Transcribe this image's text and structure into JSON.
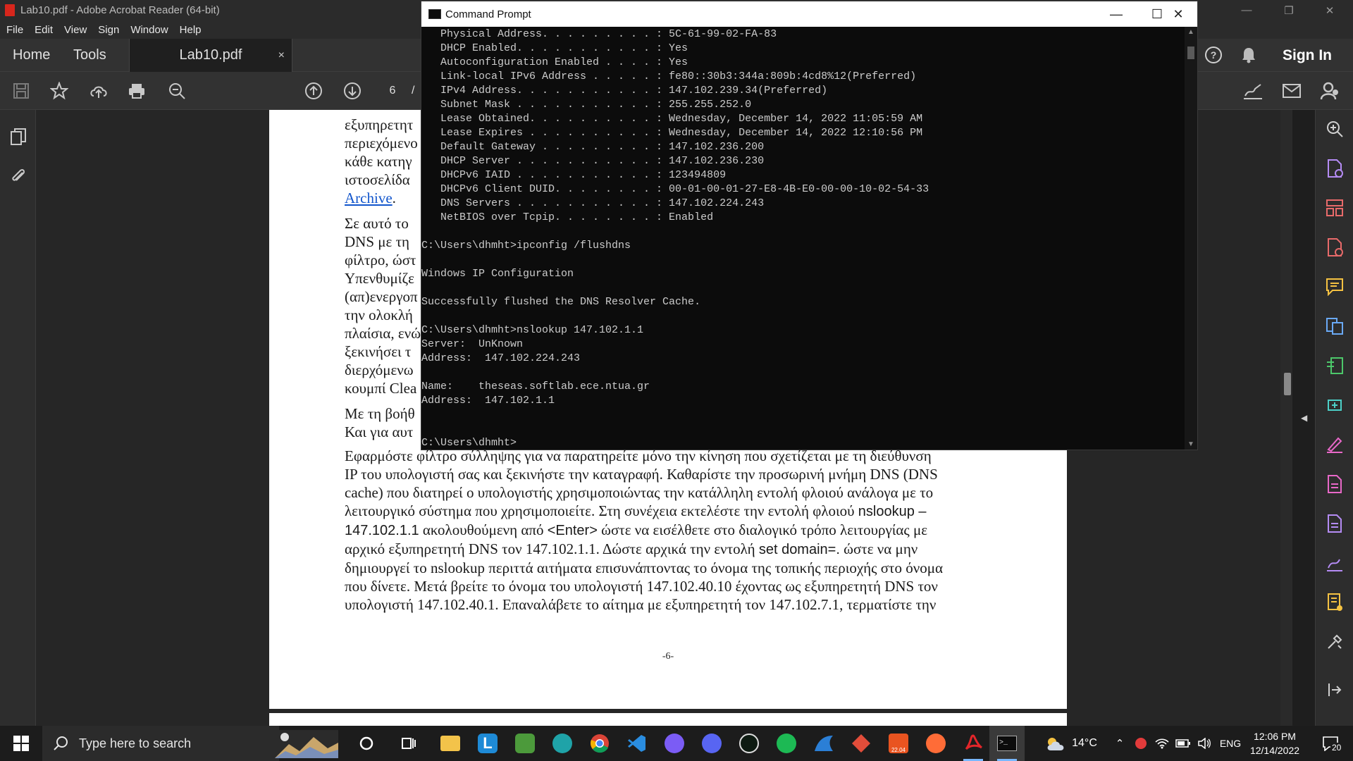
{
  "acrobat": {
    "window_title": "Lab10.pdf - Adobe Acrobat Reader (64-bit)",
    "menu": [
      "File",
      "Edit",
      "View",
      "Sign",
      "Window",
      "Help"
    ],
    "tabs": {
      "home": "Home",
      "tools": "Tools",
      "doc": "Lab10.pdf",
      "close": "×"
    },
    "sign_in": "Sign In",
    "page_number": "6",
    "page_sep": "/",
    "pdf": {
      "left_fragments": [
        "εξυπηρετητ",
        "περιεχόμενο",
        "κάθε κατηγ",
        "ιστοσελίδα",
        "Archive",
        ".",
        "Σε αυτό το",
        "DNS με τη",
        "φίλτρο, ώστ",
        "Υπενθυμίζε",
        "(απ)ενεργοπ",
        "την ολοκλή",
        "πλαίσια, ενώ",
        "ξεκινήσει τ",
        "διερχόμενω",
        "κουμπί Clea",
        "Με τη βοήθ",
        "Και για αυτ"
      ],
      "line1": "Εφαρμόστε φίλτρο σύλληψης για να παρατηρείτε μόνο την κίνηση που σχετίζεται με τη διεύθυνση",
      "line2": "IP του υπολογιστή σας και ξεκινήστε την καταγραφή. Καθαρίστε την προσωρινή μνήμη DNS (DNS",
      "line3": "cache) που διατηρεί ο υπολογιστής χρησιμοποιώντας την κατάλληλη εντολή φλοιού ανάλογα με το",
      "line4a": "λειτουργικό σύστημα που χρησιμοποιείτε. Στη συνέχεια εκτελέστε την εντολή φλοιού",
      "line4b": "nslookup –",
      "line5a": "147.102.1.1",
      "line5b": "ακολουθούμενη από",
      "line5c": "<Enter>",
      "line5d": "ώστε να εισέλθετε στο διαλογικό τρόπο λειτουργίας με",
      "line6a": "αρχικό εξυπηρετητή DNS τον 147.102.1.1. Δώστε αρχικά την εντολή",
      "line6b": "set domain=.",
      "line6c": "ώστε να μην",
      "line7": "δημιουργεί το nslookup περιττά αιτήματα επισυνάπτοντας το όνομα της τοπικής περιοχής στο όνομα",
      "line8": "που δίνετε. Μετά βρείτε το όνομα του υπολογιστή 147.102.40.10 έχοντας ως εξυπηρετητή DNS τον",
      "line9": "υπολογιστή 147.102.40.1. Επαναλάβετε το αίτημα με εξυπηρετητή τον 147.102.7.1, τερματίστε την",
      "footer": "-6-"
    }
  },
  "cmd": {
    "title": "Command Prompt",
    "lines": [
      "   Physical Address. . . . . . . . . : 5C-61-99-02-FA-83",
      "   DHCP Enabled. . . . . . . . . . . : Yes",
      "   Autoconfiguration Enabled . . . . : Yes",
      "   Link-local IPv6 Address . . . . . : fe80::30b3:344a:809b:4cd8%12(Preferred)",
      "   IPv4 Address. . . . . . . . . . . : 147.102.239.34(Preferred)",
      "   Subnet Mask . . . . . . . . . . . : 255.255.252.0",
      "   Lease Obtained. . . . . . . . . . : Wednesday, December 14, 2022 11:05:59 AM",
      "   Lease Expires . . . . . . . . . . : Wednesday, December 14, 2022 12:10:56 PM",
      "   Default Gateway . . . . . . . . . : 147.102.236.200",
      "   DHCP Server . . . . . . . . . . . : 147.102.236.230",
      "   DHCPv6 IAID . . . . . . . . . . . : 123494809",
      "   DHCPv6 Client DUID. . . . . . . . : 00-01-00-01-27-E8-4B-E0-00-00-10-02-54-33",
      "   DNS Servers . . . . . . . . . . . : 147.102.224.243",
      "   NetBIOS over Tcpip. . . . . . . . : Enabled",
      "",
      "C:\\Users\\dhmht>ipconfig /flushdns",
      "",
      "Windows IP Configuration",
      "",
      "Successfully flushed the DNS Resolver Cache.",
      "",
      "C:\\Users\\dhmht>nslookup 147.102.1.1",
      "Server:  UnKnown",
      "Address:  147.102.224.243",
      "",
      "Name:    theseas.softlab.ece.ntua.gr",
      "Address:  147.102.1.1",
      "",
      "",
      "C:\\Users\\dhmht>"
    ]
  },
  "taskbar": {
    "search_placeholder": "Type here to search",
    "weather": "14°C",
    "language": "ENG",
    "time": "12:06 PM",
    "date": "12/14/2022",
    "notifications": "20",
    "ubuntu_badge": "22.04"
  },
  "colors": {
    "acrobat_bg": "#323232",
    "cmd_bg": "#0c0c0c",
    "cmd_text": "#cccccc",
    "accent_purple": "#b58cf5",
    "link": "#1155cc"
  }
}
